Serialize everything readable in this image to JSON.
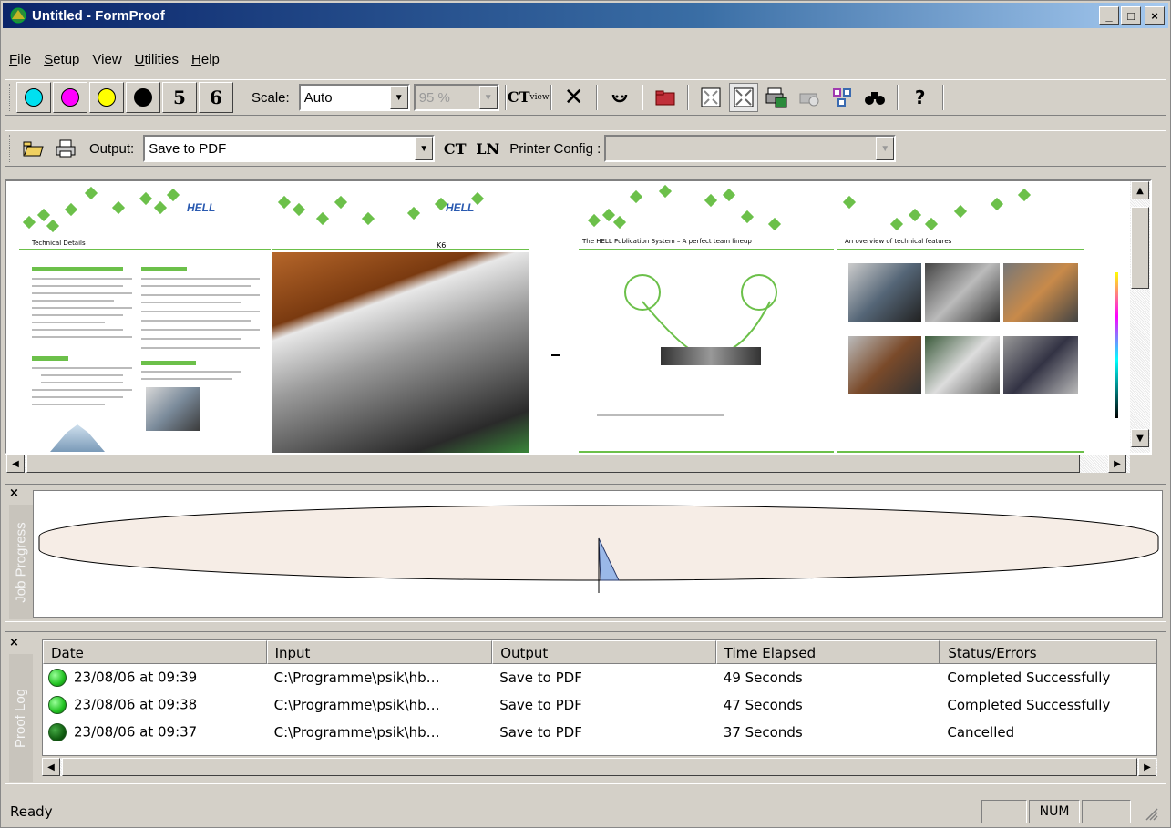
{
  "window": {
    "title": "Untitled - FormProof",
    "minimize": "_",
    "maximize": "□",
    "close": "×"
  },
  "menu": [
    {
      "label": "File",
      "accel": "F"
    },
    {
      "label": "Setup",
      "accel": "S"
    },
    {
      "label": "View",
      "accel": ""
    },
    {
      "label": "Utilities",
      "accel": "U"
    },
    {
      "label": "Help",
      "accel": "H"
    }
  ],
  "toolbar1": {
    "colors": {
      "cyan": "#00e0f0",
      "magenta": "#ff00ff",
      "yellow": "#ffff00",
      "black": "#000000"
    },
    "btn5": "5",
    "btn6": "6",
    "scale_label": "Scale:",
    "scale_value": "Auto",
    "zoom_value": "95 %",
    "ct_view": "CT",
    "ct_view_small": "view"
  },
  "toolbar2": {
    "output_label": "Output:",
    "output_value": "Save to PDF",
    "ct": "CT",
    "ln": "LN",
    "printer_label": "Printer Config :",
    "printer_value": ""
  },
  "preview": {
    "page1_title": "Technical Details",
    "page2_caption": "K6",
    "page3_title": "The HELL Publication System – A perfect team lineup",
    "page4_title": "An overview of technical features",
    "logo": "HELL"
  },
  "job_progress": {
    "label": "Job Progress"
  },
  "proof_log": {
    "label": "Proof Log",
    "columns": [
      "Date",
      "Input",
      "Output",
      "Time Elapsed",
      "Status/Errors"
    ],
    "rows": [
      {
        "date": "23/08/06 at 09:39",
        "input": "C:\\Programme\\psik\\hb…",
        "output": "Save to PDF",
        "elapsed": "49 Seconds",
        "status": "Completed Successfully",
        "dot": "#22c222"
      },
      {
        "date": "23/08/06 at 09:38",
        "input": "C:\\Programme\\psik\\hb…",
        "output": "Save to PDF",
        "elapsed": "47 Seconds",
        "status": "Completed Successfully",
        "dot": "#22c222"
      },
      {
        "date": "23/08/06 at 09:37",
        "input": "C:\\Programme\\psik\\hb…",
        "output": "Save to PDF",
        "elapsed": "37 Seconds",
        "status": "Cancelled",
        "dot": "#126012"
      }
    ]
  },
  "status": {
    "text": "Ready",
    "num": "NUM"
  }
}
